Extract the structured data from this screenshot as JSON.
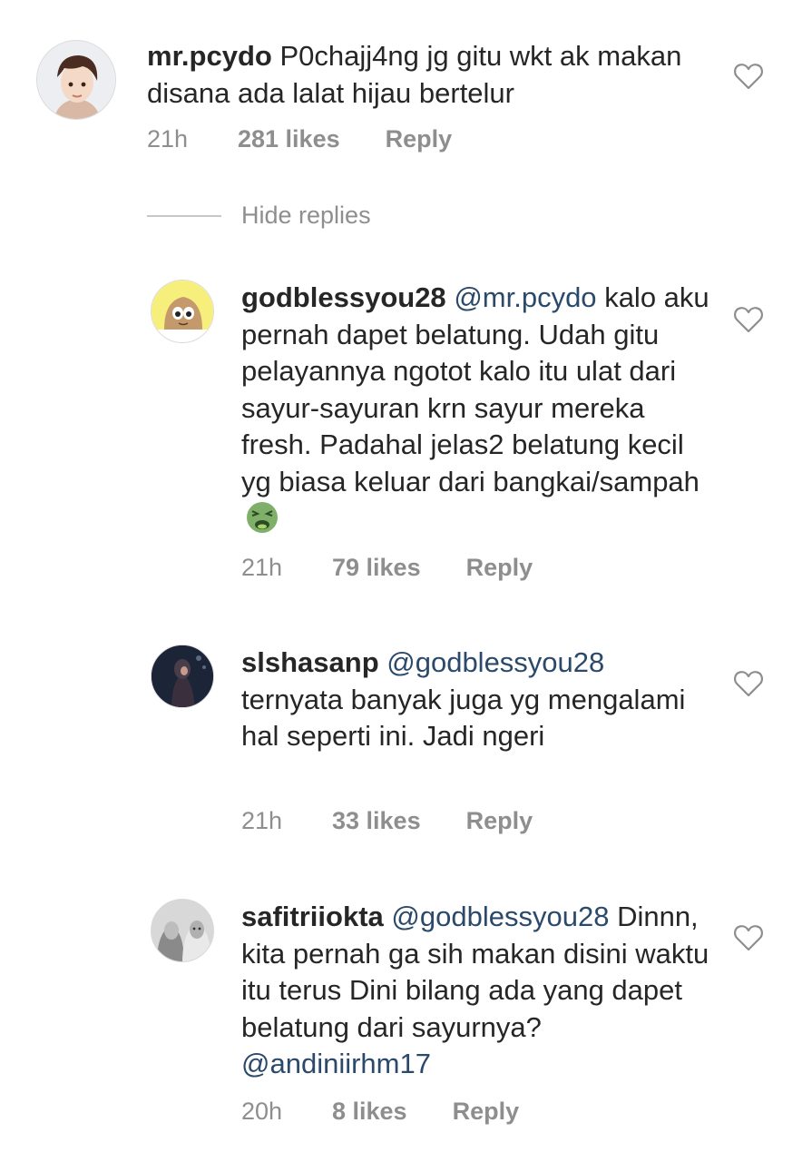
{
  "comments": [
    {
      "username": "mr.pcydo",
      "mention": "",
      "text": "P0chajj4ng jg gitu wkt ak makan disana ada lalat hijau bertelur",
      "time": "21h",
      "likes": "281 likes",
      "reply": "Reply",
      "avatar_icon": "boy-illustration-avatar"
    },
    {
      "username": "godblessyou28",
      "mention": "@mr.pcydo",
      "text": "kalo aku pernah dapet belatung. Udah gitu pelayannya ngotot kalo itu ulat dari sayur-sayuran krn sayur mereka fresh. Padahal jelas2 belatung kecil yg biasa keluar dari bangkai/sampah",
      "emoji": "nauseated-face-emoji",
      "time": "21h",
      "likes": "79 likes",
      "reply": "Reply",
      "avatar_icon": "pou-avatar"
    },
    {
      "username": "slshasanp",
      "mention": "@godblessyou28",
      "text": "ternyata banyak juga yg mengalami hal seperti ini. Jadi ngeri",
      "time": "21h",
      "likes": "33 likes",
      "reply": "Reply",
      "avatar_icon": "dark-hijab-avatar"
    },
    {
      "username": "safitriiokta",
      "mention": "@godblessyou28",
      "text": "Dinnn, kita pernah ga sih makan disini waktu itu terus Dini bilang ada yang dapet belatung dari sayurnya?",
      "trailing_mention": "@andiniirhm17",
      "time": "20h",
      "likes": "8 likes",
      "reply": "Reply",
      "avatar_icon": "two-girls-avatar"
    }
  ],
  "hide_replies": "Hide replies",
  "colors": {
    "text": "#262626",
    "meta": "#8e8e8e",
    "mention": "#2b4a6b",
    "heart": "#8e8e8e"
  }
}
